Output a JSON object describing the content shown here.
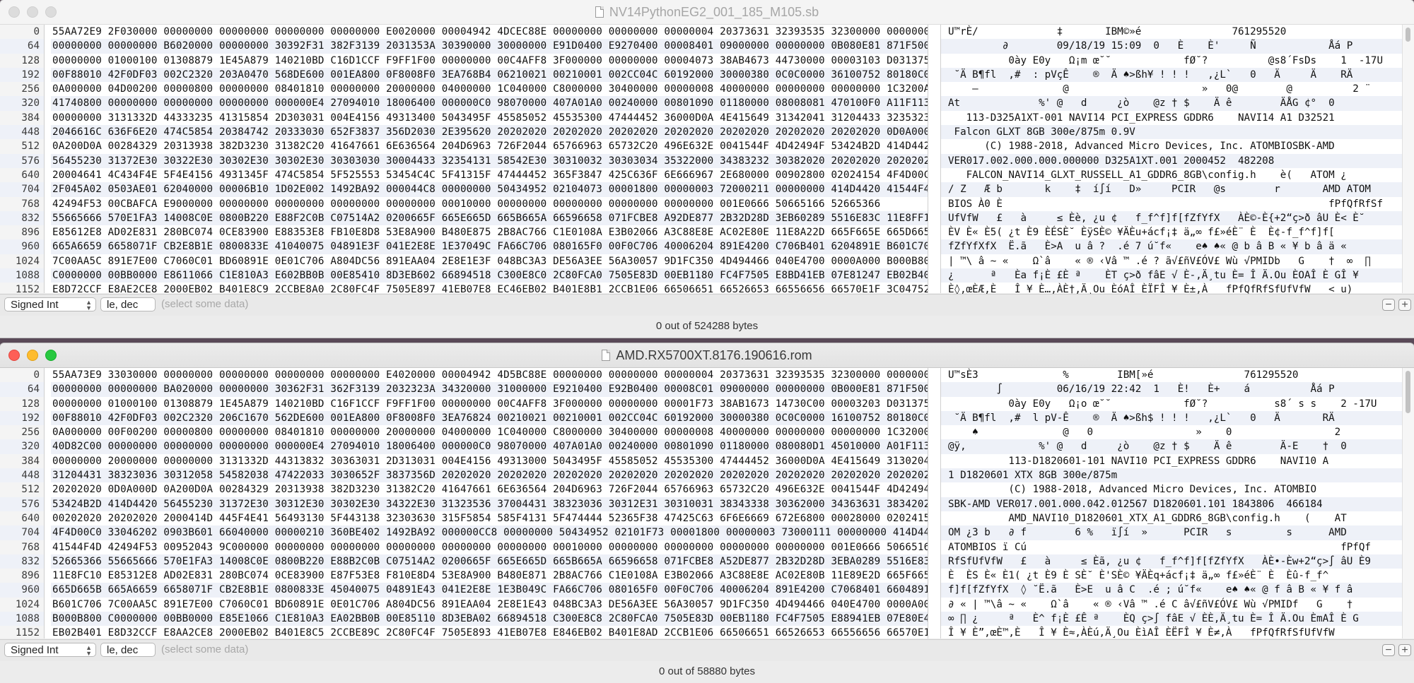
{
  "windows": [
    {
      "title": "NV14PythonEG2_001_185_M105.sb",
      "active": false,
      "offsets": [
        "0",
        "64",
        "128",
        "192",
        "256",
        "320",
        "384",
        "448",
        "512",
        "576",
        "640",
        "704",
        "768",
        "832",
        "896",
        "960",
        "1024",
        "1088",
        "1152"
      ],
      "hex_rows": [
        "55AA72E9 2F030000 00000000 00000000 00000000 00000000 E0020000 00004942 4DCEC88E 00000000 00000000 00000004 20373631 32393535 32300000 00000000",
        "00000000 00000000 B6020000 00000000 30392F31 382F3139 2031353A 30390000 30000000 E91D0400 E9270400 00008401 09000000 00000000 0B080E81 871F5000",
        "00000000 01000100 01308879 1E45A879 140210BD C16D1CCF F9FF1F00 00000000 00C4AFF8 3F000000 00000000 00004073 38AB4673 44730000 00003103 D0313755",
        "00F88010 42F0DF03 002C2320 203A0470 568DE600 001EA800 0F8008F0 3EA768B4 06210021 00210001 002CC04C 60192000 30000380 0C0C0000 36100752 80180C0E",
        "0A000000 04D00200 00000800 00000000 08401810 00000000 20000000 04000000 1C040000 C8000000 30400000 00000008 40000000 00000000 00000000 1C3200AC",
        "41740800 00000000 00000000 00000000 000000E4 27094010 18006400 000000C0 98070000 407A01A0 00240000 00801090 01180000 08008081 470100F0 A11F1130",
        "00000000 3131332D 44333235 41315854 2D303031 004E4156 49313400 5043495F 45585052 45535300 47444452 36000D0A 4E415649 31342041 31204433 32353231",
        "2046616C 636F6E20 474C5854 20384742 20333030 652F3837 356D2030 2E395620 20202020 20202020 20202020 20202020 20202020 20202020 20202020 0D0A000D",
        "0A200D0A 00284329 20313938 382D3230 31382C20 41647661 6E636564 204D6963 726F2044 65766963 65732C20 496E632E 0041544F 4D42494F 53424B2D 414D4420",
        "56455230 31372E30 30322E30 30302E30 30302E30 30303030 30004433 32354131 58542E30 30310032 30303034 35322000 34383232 30382020 20202020 20202020",
        "20004641 4C434F4E 5F4E4156 4931345F 474C5854 5F525553 53454C4C 5F41315F 47444452 365F3847 425C636F 6E666967 2E680000 00902800 02024154 4F4D00C0",
        "2F045A02 0503AE01 62040000 00006B10 1D02E002 1492BA92 000044C8 00000000 50434952 02104073 00001800 00000003 72000211 00000000 414D4420 41544F4D",
        "42494F53 00CBAFCA E9000000 00000000 00000000 00000000 00000000 00010000 00000000 00000000 00000000 00000000 001E0666 50665166 52665366",
        "55665666 570E1FA3 14008C0E 0800B220 E88F2C0B C07514A2 0200665F 665E665D 665B665A 66596658 071FCBE8 A92DE877 2B32D28D 3EB60289 5516E83C 11E8FF10",
        "E85612E8 AD02E831 280BC074 0CE83900 E88353E8 FB10E8D8 53E8A900 B480E875 2B8AC766 C1E0108A E3B02066 A3C88E8E AC02E80E 11E8A22D 665F665E 665D665B",
        "665A6659 6658071F CB2E8B1E 0800833E 41040075 04891E3F 041E2E8E 1E37049C FA66C706 080165F0 00F0C706 40006204 891E4200 C706B401 6204891E B601C706",
        "7C00AA5C 891E7E00 C7060C01 BD60891E 0E01C706 A804DC56 891EAA04 2E8E1E3F 048BC3A3 DE56A3EE 56A30057 9D1FC350 4D494466 040E4700 0000A000 B000B800",
        "C0000000 00BB0000 E8611066 C1E810A3 E602BB0B 00E85410 8D3EB602 66894518 C300E8C0 2C80FCA0 7505E83D 00EB1180 FC4F7505 E8BD41EB 07E81247 EB02B401",
        "E8D72CCF E8AE2CE8 2000EB02 B401E8C9 2CCBE8A0 2C80FC4F 7505E897 41EB07E8 EC46EB02 B401E8B1 2CCB1E06 66506651 66526653 66556656 66570E1F 3C047529"
      ],
      "text_rows": [
        "U™rÈ/             ‡       IBM©»é               761295520",
        "         ∂        09/18/19 15:09  0   È    È'     Ñ            Åá P",
        "          0ày E0y   Ω¡m œ˘˘            fØ˘?          @s8´FsDs    1  -17U",
        " ˘Ä B¶fl  ,#  : pVçÊ    ®  Ä ♠>ßh¥ ! ! !   ,¿L`   0   Ä     Ä    RÄ",
        "    –              @                      »   0@        @          2 ¨",
        "At             %' @   d     ¿ò    @z † $    Ä ê        ÄÅG ¢°  0",
        "   113-D325A1XT-001 NAVI14 PCI_EXPRESS GDDR6    NAVI14 A1 D32521",
        " Falcon GLXT 8GB 300e/875m 0.9V",
        "      (C) 1988-2018, Advanced Micro Devices, Inc. ATOMBIOSBK-AMD",
        "VER017.002.000.000.000000 D325A1XT.001 2000452  482208",
        "   FALCON_NAVI14_GLXT_RUSSELL_A1_GDDR6_8GB\\config.h    è(   ATOM ¿",
        "/ Z   Æ b       k    ‡  í∫í   D»     PCIR   @s        r       AMD ATOM",
        "BIOS À0 È                                                      fPfQfRfSf",
        "UfVfW   £   à     ≤ Èè, ¿u ¢   f_f^f]f[fZfYfX   ÀÈ©-È{+2“ç>ð âU È< È˘",
        "ÈV È« È5( ¿t È9 ÈÉSÈ˘ ÈÿSÈ© ¥ÄÈu+ácf¡‡ ä„∞ f£»éÈ¨ È  È¢-f_f^f]f[",
        "fZfYfXfX  Ë.ã   È>A  u â ?  .é 7 ú˘f«    e♠ ♠« @ b â B « ¥ b â ä «",
        "| ™\\ â ~ «    Ω`â    « ® ‹Vâ ™ .é ? ã√£ñV£ÓV£ Wù √PMIDb   G    †  ∞  ∏",
        "¿      ª   Èa f¡È £È ª    ÈT ç>ð fâE √ È-,Ä¸tu È= Î Ä.Ou ÈOAÎ È GÎ ¥",
        "È◊,œÈÆ,È   Î ¥ È…,ÀÈ†,Ä¸Ou ÈóAÎ ÈÏFÎ ¥ È±,À   fPfQfRfSfUfVfW   < u)"
      ],
      "type_popup": "Signed Int",
      "endian_popup": "le, dec",
      "hint": "(select some data)",
      "status": "0 out of 524288 bytes"
    },
    {
      "title": "AMD.RX5700XT.8176.190616.rom",
      "active": true,
      "offsets": [
        "0",
        "64",
        "128",
        "192",
        "256",
        "320",
        "384",
        "448",
        "512",
        "576",
        "640",
        "704",
        "768",
        "832",
        "896",
        "960",
        "1024",
        "1088",
        "1152"
      ],
      "hex_rows": [
        "55AA73E9 33030000 00000000 00000000 00000000 00000000 E4020000 00004942 4D5BC88E 00000000 00000000 00000004 20373631 32393535 32300000 00000000",
        "00000000 00000000 BA020000 00000000 30362F31 362F3139 2032323A 34320000 31000000 E9210400 E92B0400 00008C01 09000000 00000000 0B000E81 871F5000",
        "00000000 01000100 01308879 1E45A879 140210BD C16F1CCF F9FF1F00 00000000 00C4AFF8 3F000000 00000000 00001F73 38AB1673 14730C00 00003203 D0313755",
        "00F88010 42F0DF03 002C2320 206C1670 562DE600 001EA800 0F8008F0 3EA76824 00210021 00210001 002CC04C 60192000 30000380 0C0C0000 16100752 80180C0E",
        "0A000000 00F00200 00000800 00000000 08401810 00000000 20000000 04000000 1C040000 C8000000 30400000 00000008 40000000 00000000 00000000 1C320008",
        "40D82C00 00000000 00000000 00000000 000000E4 27094010 18006400 000000C0 98070000 407A01A0 00240000 00801090 01180000 080080D1 45010000 A01F1130",
        "00000000 20000000 00000000 3131332D 44313832 30363031 2D313031 004E4156 49313000 5043495F 45585052 45535300 47444452 36000D0A 4E415649 31302041",
        "31204431 38323036 30312058 54582038 47422033 3030652F 3837356D 20202020 20202020 20202020 20202020 20202020 20202020 20202020 20202020 20202020",
        "20202020 0D0A000D 0A200D0A 00284329 20313938 382D3230 31382C20 41647661 6E636564 204D6963 726F2044 65766963 65732C20 496E632E 0041544F 4D42494F",
        "53424B2D 414D4420 56455230 31372E30 30312E30 30302E30 34322E30 31323536 37004431 38323036 30312E31 30310031 38343338 30362000 34363631 38342020",
        "00202020 20202020 2000414D 445F4E41 56493130 5F443138 32303630 315F5854 585F4131 5F474444 52365F38 47425C63 6F6E6669 672E6800 00028000 02024154",
        "4F4D00C0 33046202 0903B601 66040000 00000210 360BE402 1492BA92 000000CC8 00000000 50434952 02101F73 00001800 00000003 73000111 00000000 414D4420",
        "41544F4D 42494F53 00952043 9C000000 00000000 00000000 00000000 00000000 00000000 00010000 00000000 00000000 00000000 00000000 001E0666 50665166",
        "52665366 55665666 570E1FA3 14008C0E 0800B220 E88B2C0B C07514A2 0200665F 665E665D 665B665A 66596658 071FCBE8 A52DE877 2B32D28D 3EBA0289 5516E839",
        "11E8FC10 E85312E8 AD02E831 280BC074 0CE83900 E87F53E8 F810E8D4 53E8A900 B480E871 2B8AC766 C1E0108A E3B02066 A3C88E8E AC02E80B 11E89E2D 665F665E",
        "665D665B 665A6659 6658071F CB2E8B1E 0800833E 45040075 04891E43 041E2E8E 1E3B049C FA66C706 080165F0 00F0C706 40006204 891E4200 C7068401 6604891E",
        "B601C706 7C00AA5C 891E7E00 C7060C01 BD60891E 0E01C706 A804DC56 891EAA04 2E8E1E43 048BC3A3 DE56A3EE 56A30057 9D1FC350 4D494466 040E4700 0000A000",
        "B000B800 C0000000 00BB0000 E85E1066 C1E810A3 EA02BB0B 00E85110 8D3EBA02 66894518 C300E8C8 2C80FCA0 7505E83D 00EB1180 FC4F7505 E88941EB 07E80E47",
        "EB02B401 E8D32CCF E8AA2CE8 2000EB02 B401E8C5 2CCBE89C 2C80FC4F 7505E893 41EB07E8 E846EB02 B401E8AD 2CCB1E06 66506651 66526653 66556656 66570E1F"
      ],
      "text_rows": [
        "U™sÈ3              %        IBM[»é               761295520",
        "        ∫         06/16/19 22:42  1   È!   È+    á          Åá P",
        "          0ày E0y   Ω¡o œ˘˘            fØ˘?           s8´ s s    2 -17U",
        " ˘Ä B¶fl  ,#  l pV-Ê    ®  Ä ♠>ßh$ ! ! !   ,¿L`   0   Ä       RÄ",
        "    ♠              @   0                 »    0                 2",
        "@ÿ,            %' @   d     ¿ò    @z † $    Ä ê        Ä-E    †  0",
        "          113-D1820601-101 NAVI10 PCI_EXPRESS GDDR6    NAVI10 A",
        "1 D1820601 XTX 8GB 300e/875m",
        "          (C) 1988-2018, Advanced Micro Devices, Inc. ATOMBIO",
        "SBK-AMD VER017.001.000.042.012567 D1820601.101 1843806  466184",
        "          AMD_NAVI10_D1820601_XTX_A1_GDDR6_8GB\\config.h    (    AT",
        "OM ¿3 b   ∂ f        6 %   ï∫í  »      PCIR   s         s      AMD",
        "ATOMBIOS ï Cú                                                    fPfQf",
        "RfSfUfVfW   £   à     ≤ Èã, ¿u ¢   f_f^f]f[fZfYfX   ÀÈ•-Èw+2“ç>∫ âU È9",
        "È  ÈS È« È1( ¿t È9 È SÈ˘ È'SÈ© ¥ÄÈq+ácf¡‡ ä„∞ f£»éÈ¨ È  Èû-f_f^",
        "f]f[fZfYfX  ◊ ˘Ë.ã   È>E  u â C  .é ; ú˘f«    e♠ ♠« @ f â B « ¥ f â",
        "∂ « | ™\\â ~ «    Ω`â    « ® ‹Vâ ™ .é C â√£ñV£ÓV£ Wù √PMIDf   G    †",
        "∞ ∏ ¿     ª   È^ f¡È £Ê ª    ÈQ ç>∫ fâE √ ÈÈ,Ä¸tu È= Î Ä.Ou ÈmAÎ È G",
        "Î ¥ È”,œÈ™,È   Î ¥ È≈,ÀÈú,Ä¸Ou ÈìAÎ ÈËFÎ ¥ È≠,À   fPfQfRfSfUfVfW"
      ],
      "type_popup": "Signed Int",
      "endian_popup": "le, dec",
      "hint": "(select some data)",
      "status": "0 out of 58880 bytes"
    }
  ]
}
